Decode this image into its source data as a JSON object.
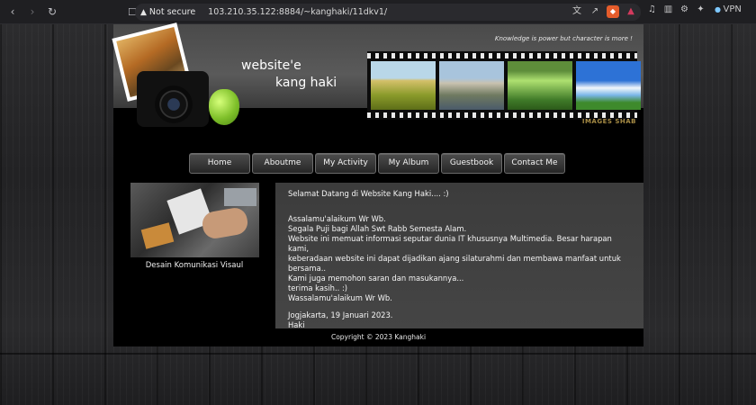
{
  "browser": {
    "security_label": "Not secure",
    "url": "103.210.35.122:8884/~kanghaki/11dkv1/",
    "vpn_label": "VPN"
  },
  "header": {
    "motto": "Knowledge is power but character is more !",
    "title_line1": "website'e",
    "title_line2": "kang haki",
    "film_caption": "IMAGES SHAB"
  },
  "menu": [
    {
      "label": "Home"
    },
    {
      "label": "Aboutme"
    },
    {
      "label": "My Activity"
    },
    {
      "label": "My Album"
    },
    {
      "label": "Guestbook"
    },
    {
      "label": "Contact Me"
    }
  ],
  "sidebar": {
    "caption": "Desain Komunikasi Visaul"
  },
  "content": {
    "welcome": "Selamat Datang di Website Kang Haki.... :)",
    "greeting": "Assalamu'alaikum Wr Wb.",
    "line1": "Segala Puji bagi Allah Swt Rabb Semesta Alam.",
    "line2": "Website ini memuat informasi seputar dunia IT khususnya Multimedia. Besar harapan kami,",
    "line3": "keberadaan website ini dapat dijadikan ajang silaturahmi dan membawa manfaat untuk bersama..",
    "line4": "Kami juga memohon saran dan masukannya...",
    "line5": "terima kasih.. :)",
    "closing": "Wassalamu'alaikum Wr Wb.",
    "place_date": "Jogjakarta, 19 Januari 2023.",
    "signature": "Haki"
  },
  "footer": {
    "copyright": "Copyright © 2023 Kanghaki"
  }
}
